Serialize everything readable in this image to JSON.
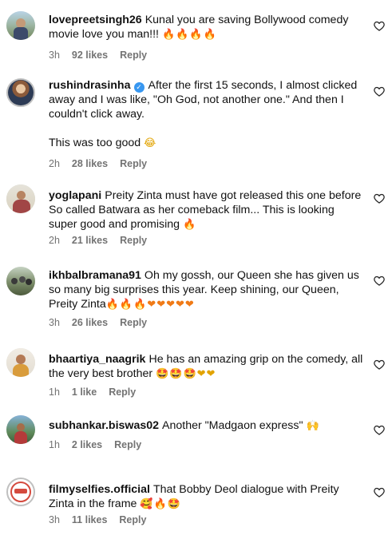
{
  "comments": [
    {
      "username": "lovepreetsingh26",
      "verified": false,
      "text": "Kunal you are saving Bollywood comedy movie love you man!!!",
      "emojis": "🔥🔥🔥🔥",
      "time": "3h",
      "likes": "92 likes",
      "reply": "Reply"
    },
    {
      "username": "rushindrasinha",
      "verified": true,
      "text": "After the first 15 seconds, I almost clicked away and I was like, \"Oh God, not another one.\" And then I couldn't click away.",
      "text2": "This was too good",
      "emojis": "😂",
      "time": "2h",
      "likes": "28 likes",
      "reply": "Reply"
    },
    {
      "username": "yoglapani",
      "verified": false,
      "text": "Preity Zinta must have got released this one before So called Batwara as her comeback film... This is looking super good and promising",
      "emojis": "🔥",
      "time": "2h",
      "likes": "21 likes",
      "reply": "Reply"
    },
    {
      "username": "ikhbalbramana91",
      "verified": false,
      "text": "Oh my gossh, our Queen she has given us so many big surprises this year. Keep shining, our Queen, Preity Zinta",
      "emojis": "🔥🔥🔥❤❤❤❤❤",
      "time": "3h",
      "likes": "26 likes",
      "reply": "Reply"
    },
    {
      "username": "bhaartiya_naagrik",
      "verified": false,
      "text": "He has an amazing grip on the comedy, all the very best brother",
      "emojis": "🤩🤩🤩❤❤",
      "time": "1h",
      "likes": "1 like",
      "reply": "Reply"
    },
    {
      "username": "subhankar.biswas02",
      "verified": false,
      "text": "Another \"Madgaon express\"",
      "emojis": "🙌",
      "time": "1h",
      "likes": "2 likes",
      "reply": "Reply"
    },
    {
      "username": "filmyselfies.official",
      "verified": false,
      "text": "That Bobby Deol dialogue with Preity Zinta in the frame",
      "emojis": "🥰🔥🤩",
      "time": "3h",
      "likes": "11 likes",
      "reply": "Reply"
    }
  ],
  "icons": {
    "like": "heart-outline-icon",
    "verified": "verified-badge-icon"
  },
  "colors": {
    "meta_text": "#737373",
    "verified_badge": "#3897f0",
    "fire": "#f07a16",
    "heart": "#e0152b"
  }
}
